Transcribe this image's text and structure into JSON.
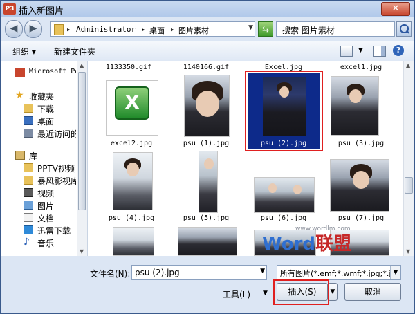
{
  "window": {
    "app_badge": "P3",
    "title": "插入新图片",
    "close_glyph": "✕"
  },
  "address": {
    "back_glyph": "◀",
    "forward_glyph": "▶",
    "crumb_sep": "▸",
    "crumbs": [
      "Administrator",
      "桌面",
      "图片素材"
    ],
    "refresh_glyph": "⇆",
    "search_placeholder": "搜索 图片素材"
  },
  "toolbar": {
    "organize": "组织 ▾",
    "new_folder": "新建文件夹",
    "help": "?"
  },
  "navpane": {
    "items": [
      {
        "label": "Microsoft Po",
        "icon": "powerpoint-icon"
      },
      {
        "label": "收藏夹",
        "icon": "star-icon"
      },
      {
        "label": "下载",
        "icon": "folder-icon"
      },
      {
        "label": "桌面",
        "icon": "desktop-icon"
      },
      {
        "label": "最近访问的",
        "icon": "recent-icon"
      },
      {
        "label": "库",
        "icon": "library-icon"
      },
      {
        "label": "PPTV视频",
        "icon": "folder-icon"
      },
      {
        "label": "暴风影视库",
        "icon": "folder-icon"
      },
      {
        "label": "视频",
        "icon": "video-icon"
      },
      {
        "label": "图片",
        "icon": "pictures-icon"
      },
      {
        "label": "文档",
        "icon": "documents-icon"
      },
      {
        "label": "迅雷下载",
        "icon": "download-icon"
      },
      {
        "label": "音乐",
        "icon": "music-icon"
      }
    ]
  },
  "files": {
    "row0": [
      "1133350.gif",
      "1140166.gif",
      "Excel.jpg",
      "excel1.jpg"
    ],
    "row1": [
      "excel2.jpg",
      "psu (1).jpg",
      "psu (2).jpg",
      "psu (3).jpg"
    ],
    "row2": [
      "psu (4).jpg",
      "psu (5).jpg",
      "psu (6).jpg",
      "psu (7).jpg"
    ]
  },
  "watermark": {
    "url": "www.wordlm.com",
    "word": "Word",
    "union": "联盟"
  },
  "bottom": {
    "filename_label": "文件名(N):",
    "filename_value": "psu (2).jpg",
    "filetype_value": "所有图片(*.emf;*.wmf;*.jpg;*.jp",
    "tools_label": "工具(L)",
    "insert_label": "插入(S)",
    "cancel_label": "取消"
  },
  "colors": {
    "selection": "#0d2a8a",
    "highlight_frame": "#e02020"
  }
}
